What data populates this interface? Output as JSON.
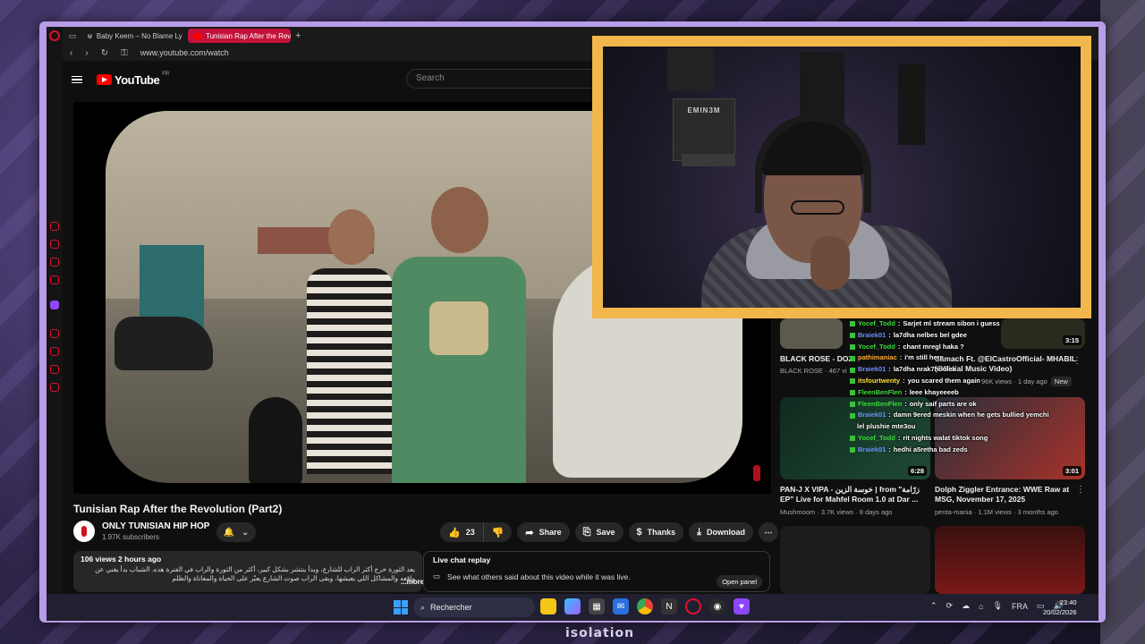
{
  "browser": {
    "tabs": [
      {
        "label": "Baby Keem – No Blame Ly",
        "active": false
      },
      {
        "label": "Tunisian Rap After the Rev",
        "active": true
      }
    ],
    "url": "www.youtube.com/watch"
  },
  "youtube": {
    "logo_text": "YouTube",
    "region": "FR",
    "search_placeholder": "Search"
  },
  "video": {
    "title": "Tunisian Rap After the Revolution (Part2)",
    "channel_name": "ONLY TUNISIAN HIP HOP",
    "subscribers": "1.97K subscribers",
    "likes": "23",
    "actions": {
      "share": "Share",
      "save": "Save",
      "thanks": "Thanks",
      "download": "Download"
    },
    "views_time": "106 views  2 hours ago",
    "description": "بعد الثورة خرج أكثر الراب للشارع، وبدأ ينتشر بشكل كبير، أكثر من الثورة والراب في الفترة هذه. الشباب بدأ يغني عن واقعه والمشاكل اللي يعيشها، وبقى الراب صوت الشارع يعبّر على الحياة والمعاناة والظلم",
    "more_label": "...more",
    "live_chat_title": "Live chat replay",
    "live_chat_text": "See what others said about this video while it was live.",
    "open_panel_label": "Open panel"
  },
  "webcam": {
    "poster_text": "EMIN3M"
  },
  "recommendations": [
    {
      "title": "BLACK ROSE - DOZ",
      "meta": "BLACK ROSE · 467 vi",
      "duration": ""
    },
    {
      "title": "Samach Ft. @ElCastroOfficial- MHABIL (Official Music Video)",
      "meta": "96K views · 1 day ago",
      "badge": "New",
      "duration": "3:15"
    },
    {
      "title": "PAN-J X VIPA - خوسة الزين | from \"زرّامة EP\" Live for Mahfel Room 1.0 at Dar ...",
      "meta": "Mushmoom · 3.7K views · 8 days ago",
      "duration": "6:28"
    },
    {
      "title": "Dolph Ziggler Entrance: WWE Raw at MSG, November 17, 2025",
      "meta": "penta-mania · 1.1M views · 3 months ago",
      "duration": "3:01"
    }
  ],
  "chat": [
    {
      "user": "Yocef_Todd",
      "color": "#3cd63c",
      "msg": "Sarjet ml stream sibon i guess"
    },
    {
      "user": "Braiek01",
      "color": "#6b8cff",
      "msg": "la7dha nelbes bel gdee"
    },
    {
      "user": "Yocef_Todd",
      "color": "#3cd63c",
      "msg": "chant mregl haka ?"
    },
    {
      "user": "pathimaniac",
      "color": "#ffaa33",
      "msg": "i'm still here"
    },
    {
      "user": "Braiek01",
      "color": "#6b8cff",
      "msg": "la7dha nrak7hoolek"
    },
    {
      "user": "itsfourtwenty",
      "color": "#ffdd33",
      "msg": "you scared them again"
    },
    {
      "user": "FleenBenFlen",
      "color": "#3cd63c",
      "msg": "leee khayeeeeb"
    },
    {
      "user": "FleenBenFlen",
      "color": "#3cd63c",
      "msg": "only saif parts are ok"
    },
    {
      "user": "Braiek01",
      "color": "#6b8cff",
      "msg": "damn 9ered meskin when he gets bullied yemchi"
    },
    {
      "user": "",
      "color": "#ffffff",
      "msg": "lel plushie mte3ou"
    },
    {
      "user": "Yocef_Todd",
      "color": "#3cd63c",
      "msg": "rit nights walat tiktok song"
    },
    {
      "user": "Braiek01",
      "color": "#6b8cff",
      "msg": "hedhi a5retha bad zeds"
    }
  ],
  "taskbar": {
    "search_label": "Rechercher",
    "language": "FRA",
    "time": "23:40",
    "date": "20/02/2026"
  },
  "overlay_brand": "isolation",
  "colors": {
    "frame": "#b79de8",
    "cam_border": "#f2b74b",
    "tab_active": "#c3123a",
    "yt_red": "#ff0000"
  }
}
